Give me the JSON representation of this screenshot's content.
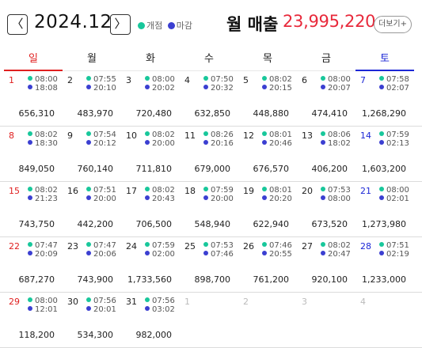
{
  "header": {
    "prev_label": "〈",
    "next_label": "〉",
    "month": "2024.12",
    "legend_open": "개점",
    "legend_close": "마감",
    "revenue_title": "월 매출",
    "revenue_amount": "23,995,220",
    "more_label": "더보기+"
  },
  "colors": {
    "open": "#18c79b",
    "close": "#3b3fd1",
    "sunday": "#e02020",
    "saturday": "#1c27d6",
    "revenue": "#e8293b"
  },
  "weekdays": [
    "일",
    "월",
    "화",
    "수",
    "목",
    "금",
    "토"
  ],
  "weeks": [
    [
      {
        "day": "1",
        "open": "08:00",
        "close": "18:08",
        "amount": "656,310"
      },
      {
        "day": "2",
        "open": "07:55",
        "close": "20:10",
        "amount": "483,970"
      },
      {
        "day": "3",
        "open": "08:00",
        "close": "20:02",
        "amount": "720,480"
      },
      {
        "day": "4",
        "open": "07:50",
        "close": "20:32",
        "amount": "632,850"
      },
      {
        "day": "5",
        "open": "08:02",
        "close": "20:15",
        "amount": "448,880"
      },
      {
        "day": "6",
        "open": "08:00",
        "close": "20:07",
        "amount": "474,410"
      },
      {
        "day": "7",
        "open": "07:58",
        "close": "02:07",
        "amount": "1,268,290"
      }
    ],
    [
      {
        "day": "8",
        "open": "08:02",
        "close": "18:30",
        "amount": "849,050"
      },
      {
        "day": "9",
        "open": "07:54",
        "close": "20:12",
        "amount": "760,140"
      },
      {
        "day": "10",
        "open": "08:02",
        "close": "20:00",
        "amount": "711,810"
      },
      {
        "day": "11",
        "open": "08:26",
        "close": "20:16",
        "amount": "679,000"
      },
      {
        "day": "12",
        "open": "08:01",
        "close": "20:46",
        "amount": "676,570"
      },
      {
        "day": "13",
        "open": "08:06",
        "close": "18:02",
        "amount": "406,200"
      },
      {
        "day": "14",
        "open": "07:59",
        "close": "02:13",
        "amount": "1,603,200"
      }
    ],
    [
      {
        "day": "15",
        "open": "08:02",
        "close": "21:23",
        "amount": "743,750"
      },
      {
        "day": "16",
        "open": "07:51",
        "close": "20:00",
        "amount": "442,200"
      },
      {
        "day": "17",
        "open": "08:02",
        "close": "20:43",
        "amount": "706,500"
      },
      {
        "day": "18",
        "open": "07:59",
        "close": "20:00",
        "amount": "548,940"
      },
      {
        "day": "19",
        "open": "08:01",
        "close": "20:20",
        "amount": "622,940"
      },
      {
        "day": "20",
        "open": "07:53",
        "close": "08:00",
        "amount": "673,520"
      },
      {
        "day": "21",
        "open": "08:00",
        "close": "02:01",
        "amount": "1,273,980"
      }
    ],
    [
      {
        "day": "22",
        "open": "07:47",
        "close": "20:09",
        "amount": "687,270"
      },
      {
        "day": "23",
        "open": "07:47",
        "close": "20:06",
        "amount": "743,900"
      },
      {
        "day": "24",
        "open": "07:59",
        "close": "02:00",
        "amount": "1,733,560"
      },
      {
        "day": "25",
        "open": "07:53",
        "close": "07:46",
        "amount": "898,700"
      },
      {
        "day": "26",
        "open": "07:46",
        "close": "20:55",
        "amount": "761,200"
      },
      {
        "day": "27",
        "open": "08:02",
        "close": "20:47",
        "amount": "920,100"
      },
      {
        "day": "28",
        "open": "07:51",
        "close": "02:19",
        "amount": "1,233,000"
      }
    ],
    [
      {
        "day": "29",
        "open": "08:00",
        "close": "12:01",
        "amount": "118,200"
      },
      {
        "day": "30",
        "open": "07:56",
        "close": "20:01",
        "amount": "534,300"
      },
      {
        "day": "31",
        "open": "07:56",
        "close": "03:02",
        "amount": "982,000"
      },
      {
        "day": "1",
        "open": "",
        "close": "",
        "amount": ""
      },
      {
        "day": "2",
        "open": "",
        "close": "",
        "amount": ""
      },
      {
        "day": "3",
        "open": "",
        "close": "",
        "amount": ""
      },
      {
        "day": "4",
        "open": "",
        "close": "",
        "amount": ""
      }
    ]
  ]
}
